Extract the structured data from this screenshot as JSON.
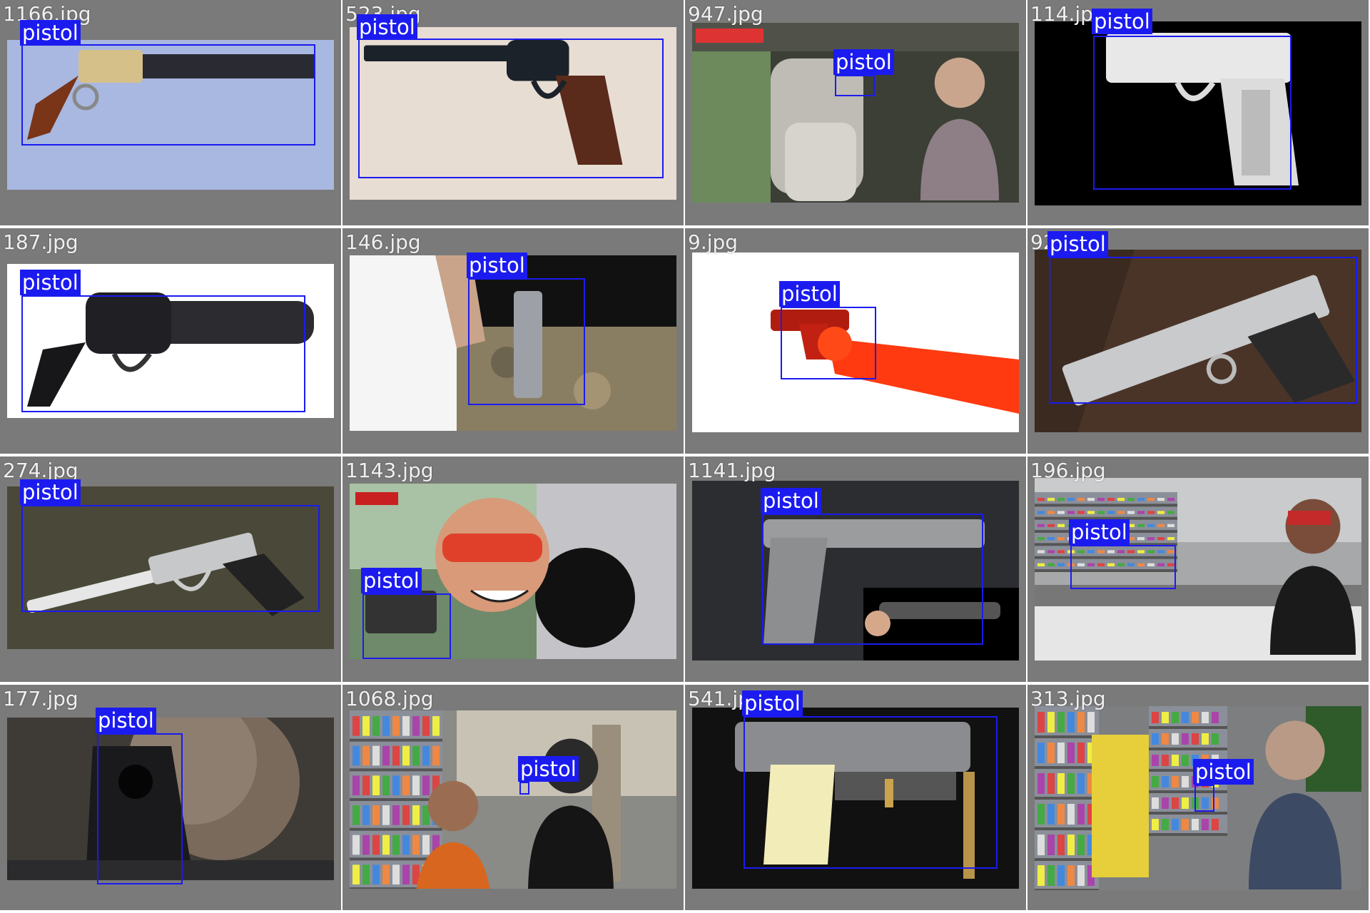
{
  "colors": {
    "cell_background": "#7a7a7a",
    "box_color": "#1b1bf0",
    "label_text": "#ffffff"
  },
  "detections": [
    {
      "file": "1166.jpg",
      "label": "pistol",
      "scene": "antique-pistol-blue"
    },
    {
      "file": "523.jpg",
      "label": "pistol",
      "scene": "revolver-wood"
    },
    {
      "file": "947.jpg",
      "label": "pistol",
      "scene": "car-interior"
    },
    {
      "file": "114.jpg",
      "label": "pistol",
      "scene": "xray-pistol"
    },
    {
      "file": "187.jpg",
      "label": "pistol",
      "scene": "stubby-revolver"
    },
    {
      "file": "146.jpg",
      "label": "pistol",
      "scene": "hand-pistol-camo"
    },
    {
      "file": "9.jpg",
      "label": "pistol",
      "scene": "red-arm-pistol"
    },
    {
      "file": "92.jpg",
      "label": "pistol",
      "scene": "silver-1911"
    },
    {
      "file": "274.jpg",
      "label": "pistol",
      "scene": "long-barrel-pistol"
    },
    {
      "file": "1143.jpg",
      "label": "pistol",
      "scene": "smiling-driver"
    },
    {
      "file": "1141.jpg",
      "label": "pistol",
      "scene": "nambu-pistol"
    },
    {
      "file": "196.jpg",
      "label": "pistol",
      "scene": "store-robbery"
    },
    {
      "file": "177.jpg",
      "label": "pistol",
      "scene": "muzzle-closeup"
    },
    {
      "file": "1068.jpg",
      "label": "pistol",
      "scene": "cctv-shop"
    },
    {
      "file": "541.jpg",
      "label": "pistol",
      "scene": "pearl-grip-pistol"
    },
    {
      "file": "313.jpg",
      "label": "pistol",
      "scene": "cctv-baskets"
    }
  ]
}
